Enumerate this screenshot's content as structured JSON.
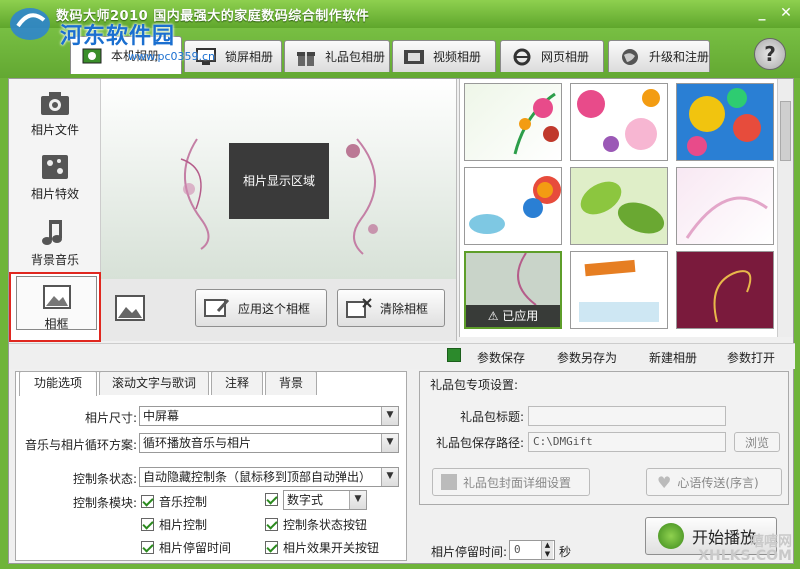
{
  "app": {
    "title": "数码大师2010    国内最强大的家庭数码综合制作软件",
    "watermark": "河东软件园",
    "watermark_url": "www.pc0359.cn",
    "bottom_watermark1": "XHLKS.COM",
    "bottom_watermark2": "嘻嘻网"
  },
  "tabs": [
    {
      "label": "本机相册",
      "icon": "photo-album-icon"
    },
    {
      "label": "锁屏相册",
      "icon": "monitor-icon"
    },
    {
      "label": "礼品包相册",
      "icon": "gift-icon"
    },
    {
      "label": "视频相册",
      "icon": "film-icon"
    },
    {
      "label": "网页相册",
      "icon": "ie-icon"
    },
    {
      "label": "升级和注册",
      "icon": "globe-icon"
    }
  ],
  "sidebar": {
    "items": [
      {
        "label": "相片文件",
        "icon": "camera-icon"
      },
      {
        "label": "相片特效",
        "icon": "effects-icon"
      },
      {
        "label": "背景音乐",
        "icon": "music-note-icon"
      },
      {
        "label": "相框",
        "icon": "frame-icon"
      }
    ]
  },
  "preview": {
    "photo_area_label": "相片显示区域",
    "apply_frame": "应用这个相框",
    "clear_frame": "清除相框"
  },
  "gallery": {
    "applied_label": "已应用"
  },
  "toolbar": {
    "save_params": "参数保存",
    "save_params_as": "参数另存为",
    "new_album": "新建相册",
    "open_params": "参数打开"
  },
  "options": {
    "tabs": [
      "功能选项",
      "滚动文字与歌词",
      "注释",
      "背景"
    ],
    "photo_size_label": "相片尺寸:",
    "photo_size_value": "中屏幕",
    "loop_label": "音乐与相片循环方案:",
    "loop_value": "循环播放音乐与相片",
    "control_state_label": "控制条状态:",
    "control_state_value": "自动隐藏控制条（鼠标移到顶部自动弹出）",
    "control_module_label": "控制条模块:",
    "checks": [
      "音乐控制",
      "相片控制",
      "相片停留时间",
      "控制条状态按钮",
      "相片效果开关按钮"
    ],
    "digit_style": "数字式"
  },
  "gift": {
    "title": "礼品包专项设置:",
    "name_label": "礼品包标题:",
    "name_value": "",
    "path_label": "礼品包保存路径:",
    "path_value": "C:\\DMGift",
    "browse": "浏览",
    "cover_btn": "礼品包封面详细设置",
    "message_btn": "心语传送(序言)"
  },
  "playback": {
    "stay_label": "相片停留时间:",
    "stay_value": "0",
    "stay_unit": "秒",
    "start_button": "开始播放"
  }
}
